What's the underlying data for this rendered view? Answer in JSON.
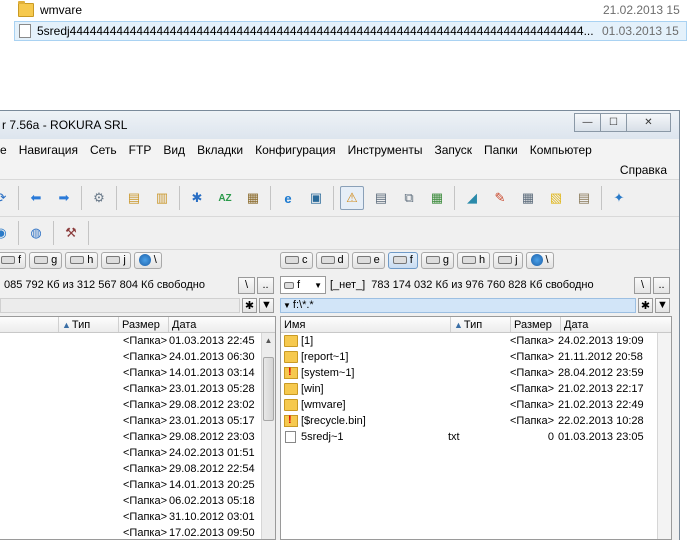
{
  "explorer": {
    "rows": [
      {
        "name": "wmvare",
        "date": "21.02.2013 15"
      },
      {
        "name": "5sredj44444444444444444444444444444444444444444444444444444444444444444444444444444...",
        "date": "01.03.2013 15"
      }
    ]
  },
  "window": {
    "title": "r 7.56a - ROKURA SRL",
    "buttons": {
      "minimize": "—",
      "maximize": "☐",
      "close": "✕"
    }
  },
  "menu": {
    "items": [
      "e",
      "Навигация",
      "Сеть",
      "FTP",
      "Вид",
      "Вкладки",
      "Конфигурация",
      "Инструменты",
      "Запуск",
      "Папки",
      "Компьютер"
    ],
    "help": "Справка"
  },
  "drives": {
    "left": [
      "f",
      "g",
      "h",
      "j",
      "\\"
    ],
    "right": [
      "c",
      "d",
      "e",
      "f",
      "g",
      "h",
      "j",
      "\\"
    ],
    "right_active": "f"
  },
  "left_panel": {
    "free_space": "085 792 Кб из 312 567 804 Кб свободно",
    "columns": {
      "ext": "Тип",
      "size": "Размер",
      "date": "Дата"
    },
    "rows": [
      {
        "size": "<Папка>",
        "date": "01.03.2013 22:45"
      },
      {
        "size": "<Папка>",
        "date": "24.01.2013 06:30"
      },
      {
        "size": "<Папка>",
        "date": "14.01.2013 03:14"
      },
      {
        "size": "<Папка>",
        "date": "23.01.2013 05:28"
      },
      {
        "size": "<Папка>",
        "date": "29.08.2012 23:02"
      },
      {
        "size": "<Папка>",
        "date": "23.01.2013 05:17"
      },
      {
        "size": "<Папка>",
        "date": "29.08.2012 23:03"
      },
      {
        "size": "<Папка>",
        "date": "24.02.2013 01:51"
      },
      {
        "size": "<Папка>",
        "date": "29.08.2012 22:54"
      },
      {
        "size": "<Папка>",
        "date": "14.01.2013 20:25"
      },
      {
        "size": "<Папка>",
        "date": "06.02.2013 05:18"
      },
      {
        "size": "<Папка>",
        "date": "31.10.2012 03:01"
      },
      {
        "size": "<Папка>",
        "date": "17.02.2013 09:50"
      }
    ]
  },
  "right_panel": {
    "drive_combo": "f",
    "volume_label": "[_нет_]",
    "free_space": "783 174 032 Кб из 976 760 828 Кб свободно",
    "path": "f:\\*.*",
    "columns": {
      "name": "Имя",
      "ext": "Тип",
      "size": "Размер",
      "date": "Дата"
    },
    "rows": [
      {
        "icon": "folder",
        "name": "[1]",
        "ext": "",
        "size": "<Папка>",
        "date": "24.02.2013 19:09"
      },
      {
        "icon": "folder",
        "name": "[report~1]",
        "ext": "",
        "size": "<Папка>",
        "date": "21.11.2012 20:58"
      },
      {
        "icon": "warn",
        "name": "[system~1]",
        "ext": "",
        "size": "<Папка>",
        "date": "28.04.2012 23:59"
      },
      {
        "icon": "folder",
        "name": "[win]",
        "ext": "",
        "size": "<Папка>",
        "date": "21.02.2013 22:17"
      },
      {
        "icon": "folder",
        "name": "[wmvare]",
        "ext": "",
        "size": "<Папка>",
        "date": "21.02.2013 22:49"
      },
      {
        "icon": "warn",
        "name": "[$recycle.bin]",
        "ext": "",
        "size": "<Папка>",
        "date": "22.02.2013 10:28"
      },
      {
        "icon": "file",
        "name": "5sredj~1",
        "ext": "txt",
        "size": "0",
        "date": "01.03.2013 23:05"
      }
    ]
  }
}
